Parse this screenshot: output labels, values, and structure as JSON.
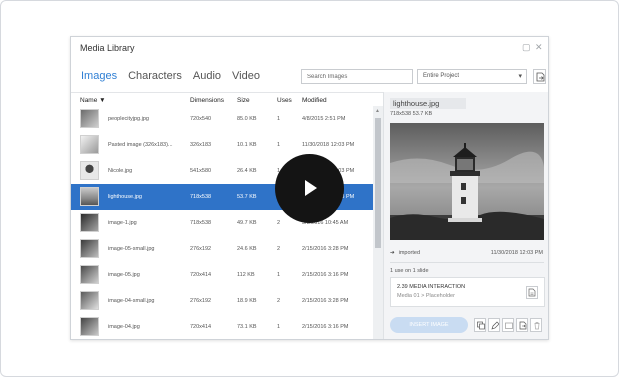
{
  "window": {
    "title": "Media Library",
    "restore_icon": "restore-icon",
    "close_icon": "close-icon"
  },
  "tabs": [
    {
      "label": "Images",
      "active": true
    },
    {
      "label": "Characters",
      "active": false
    },
    {
      "label": "Audio",
      "active": false
    },
    {
      "label": "Video",
      "active": false
    }
  ],
  "search": {
    "placeholder": "Search Images"
  },
  "scope": {
    "selected": "Entire Project"
  },
  "columns": {
    "name": "Name ▼",
    "dimensions": "Dimensions",
    "size": "Size",
    "uses": "Uses",
    "modified": "Modified"
  },
  "rows": [
    {
      "name": "peoplecityjpg.jpg",
      "dimensions": "720x540",
      "size": "85.0 KB",
      "uses": "1",
      "modified": "4/8/2015 2:51 PM",
      "selected": false
    },
    {
      "name": "Pasted image (326x183)...",
      "dimensions": "326x183",
      "size": "10.1 KB",
      "uses": "1",
      "modified": "11/30/2018 12:03 PM",
      "selected": false
    },
    {
      "name": "Nicole.jpg",
      "dimensions": "541x580",
      "size": "26.4 KB",
      "uses": "1",
      "modified": "11/30/2018 12:03 PM",
      "selected": false
    },
    {
      "name": "lighthouse.jpg",
      "dimensions": "718x538",
      "size": "53.7 KB",
      "uses": "1",
      "modified": "11/30/2018 12:03 PM",
      "selected": true
    },
    {
      "name": "image-1.jpg",
      "dimensions": "718x538",
      "size": "49.7 KB",
      "uses": "2",
      "modified": "5/3/2016 10:45 AM",
      "selected": false
    },
    {
      "name": "image-05-small.jpg",
      "dimensions": "276x192",
      "size": "24.6 KB",
      "uses": "2",
      "modified": "2/15/2016 3:28 PM",
      "selected": false
    },
    {
      "name": "image-05.jpg",
      "dimensions": "720x414",
      "size": "112 KB",
      "uses": "1",
      "modified": "2/15/2016 3:16 PM",
      "selected": false
    },
    {
      "name": "image-04-small.jpg",
      "dimensions": "276x192",
      "size": "18.9 KB",
      "uses": "2",
      "modified": "2/15/2016 3:28 PM",
      "selected": false
    },
    {
      "name": "image-04.jpg",
      "dimensions": "720x414",
      "size": "73.1 KB",
      "uses": "1",
      "modified": "2/15/2016 3:16 PM",
      "selected": false
    }
  ],
  "preview": {
    "name": "lighthouse.jpg",
    "meta": "718x538   53.7 KB",
    "imported_label": "imported",
    "imported_date": "11/30/2018 12:03 PM",
    "uses": "1 use on 1 slide",
    "slide_title": "2.39 MEDIA INTERACTION",
    "slide_path": "Media 01 > Placeholder",
    "insert_label": "INSERT IMAGE"
  },
  "colors": {
    "accent": "#2f7fd4",
    "selection": "#2f73c8",
    "insert_button": "#c9dcf2",
    "play_button": "#141414"
  },
  "icons": [
    "export-icon",
    "play-icon",
    "imported-arrow-icon",
    "slide-link-icon",
    "replace-icon",
    "edit-icon",
    "open-icon",
    "export-file-icon",
    "delete-icon"
  ]
}
